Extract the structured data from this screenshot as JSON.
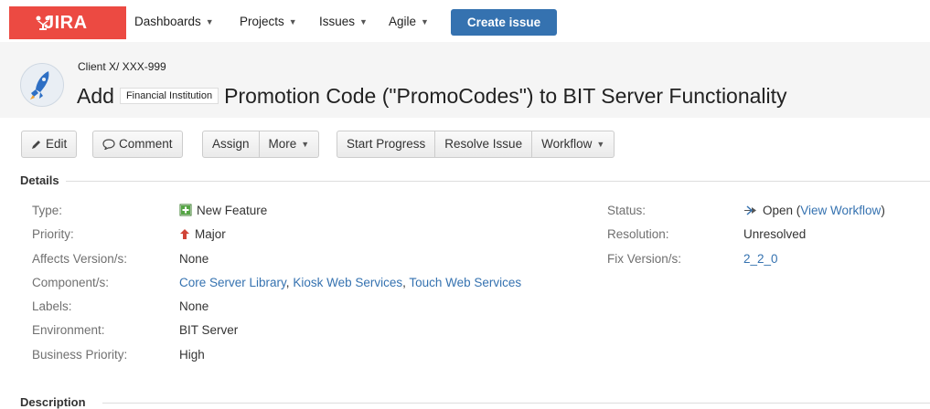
{
  "nav": {
    "logo": "JIRA",
    "items": [
      {
        "label": "Dashboards"
      },
      {
        "label": "Projects"
      },
      {
        "label": "Issues"
      },
      {
        "label": "Agile"
      }
    ],
    "create_label": "Create issue"
  },
  "issue": {
    "breadcrumb": "Client X/ XXX-999",
    "summary_prefix": "Add",
    "summary_redacted": "Financial Institution",
    "summary_suffix": "Promotion Code (\"PromoCodes\") to BIT Server Functionality"
  },
  "toolbar": {
    "edit": "Edit",
    "comment": "Comment",
    "assign": "Assign",
    "more": "More",
    "start_progress": "Start Progress",
    "resolve": "Resolve Issue",
    "workflow": "Workflow"
  },
  "details": {
    "title": "Details",
    "type_label": "Type:",
    "type_value": "New Feature",
    "priority_label": "Priority:",
    "priority_value": "Major",
    "affects_label": "Affects Version/s:",
    "affects_value": "None",
    "components_label": "Component/s:",
    "components": [
      "Core Server Library",
      "Kiosk Web Services",
      "Touch Web Services"
    ],
    "labels_label": "Labels:",
    "labels_value": "None",
    "environment_label": "Environment:",
    "environment_value": "BIT Server",
    "business_priority_label": "Business Priority:",
    "business_priority_value": "High",
    "status_label": "Status:",
    "status_value": "Open",
    "view_workflow": "View Workflow",
    "resolution_label": "Resolution:",
    "resolution_value": "Unresolved",
    "fix_label": "Fix Version/s:",
    "fix_value": "2_2_0"
  },
  "description": {
    "title": "Description"
  },
  "colors": {
    "brand": "#ec4a42",
    "primary": "#3572b0",
    "link": "#3572b0",
    "priority_major": "#d04437"
  }
}
